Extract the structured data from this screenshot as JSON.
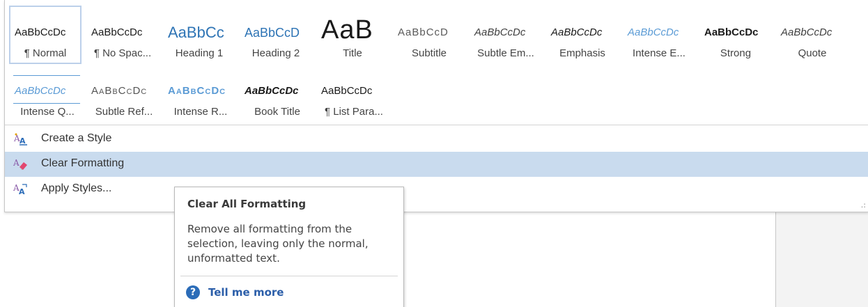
{
  "styles_row1": [
    {
      "sample": "AaBbCcDc",
      "name": "¶ Normal",
      "selected": true
    },
    {
      "sample": "AaBbCcDc",
      "name": "¶ No Spac..."
    },
    {
      "sample": "AaBbCc",
      "name": "Heading 1"
    },
    {
      "sample": "AaBbCcD",
      "name": "Heading 2"
    },
    {
      "sample": "AaB",
      "name": "Title"
    },
    {
      "sample": "AaBbCcD",
      "name": "Subtitle"
    },
    {
      "sample": "AaBbCcDc",
      "name": "Subtle Em..."
    },
    {
      "sample": "AaBbCcDc",
      "name": "Emphasis"
    },
    {
      "sample": "AaBbCcDc",
      "name": "Intense E..."
    },
    {
      "sample": "AaBbCcDc",
      "name": "Strong"
    },
    {
      "sample": "AaBbCcDc",
      "name": "Quote"
    }
  ],
  "styles_row2": [
    {
      "sample": "AaBbCcDc",
      "name": "Intense Q..."
    },
    {
      "sample": "AaBbCcDc",
      "name": "Subtle Ref..."
    },
    {
      "sample": "AaBbCcDc",
      "name": "Intense R..."
    },
    {
      "sample": "AaBbCcDc",
      "name": "Book Title"
    },
    {
      "sample": "AaBbCcDc",
      "name": "¶ List Para..."
    }
  ],
  "commands": [
    {
      "label": "Create a Style",
      "icon": "create-style-icon"
    },
    {
      "label": "Clear Formatting",
      "icon": "clear-formatting-eraser-icon",
      "highlighted": true
    },
    {
      "label": "Apply Styles...",
      "icon": "apply-styles-icon"
    }
  ],
  "tooltip": {
    "title": "Clear All Formatting",
    "body": "Remove all formatting from the selection, leaving only the normal, unformatted text.",
    "more_label": "Tell me more",
    "more_icon": "help-question-icon"
  },
  "colors": {
    "highlight": "#c9dbee",
    "heading_blue": "#2e74b5",
    "accent_blue": "#5b9bd5",
    "link_blue": "#2b5ea9",
    "selected_outline": "#bcd0ea"
  }
}
